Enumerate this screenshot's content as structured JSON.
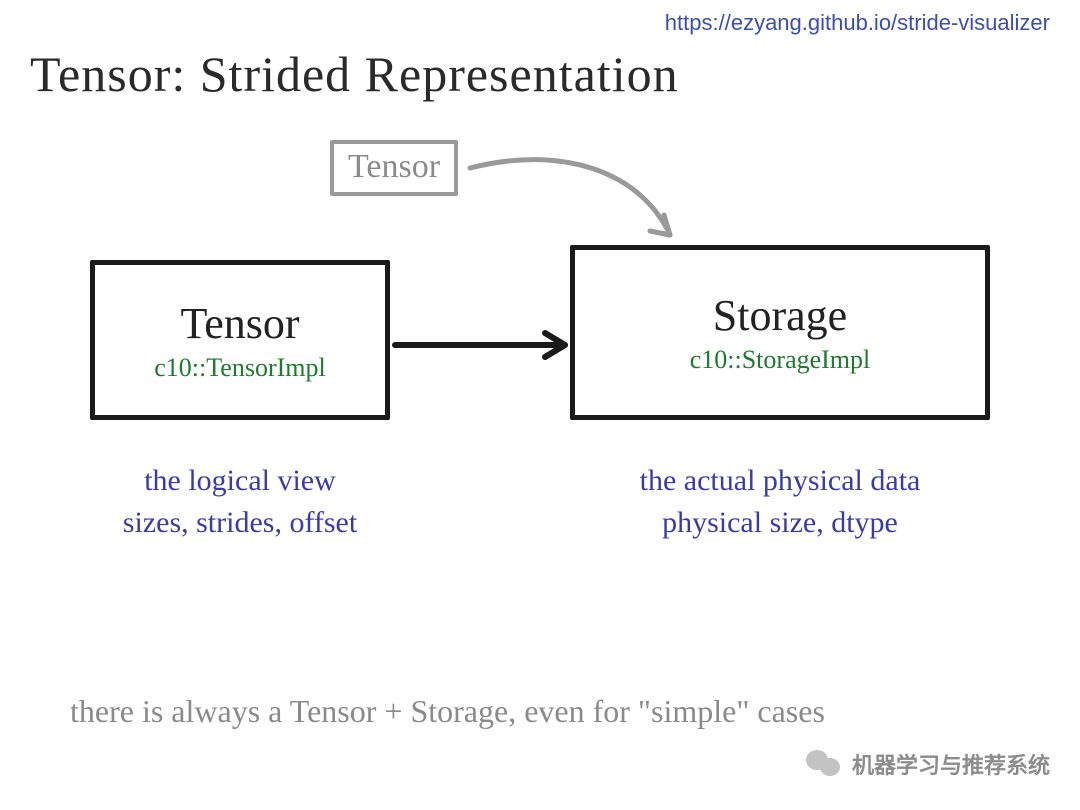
{
  "url": "https://ezyang.github.io/stride-visualizer",
  "title": "Tensor:  Strided  Representation",
  "small_tensor_label": "Tensor",
  "tensor_box": {
    "label": "Tensor",
    "impl": "c10::TensorImpl"
  },
  "storage_box": {
    "label": "Storage",
    "impl": "c10::StorageImpl"
  },
  "tensor_desc_line1": "the logical view",
  "tensor_desc_line2": "sizes, strides, offset",
  "storage_desc_line1": "the actual physical data",
  "storage_desc_line2": "physical size, dtype",
  "footnote": "there is always a Tensor + Storage,  even for  \"simple\"  cases",
  "watermark": "机器学习与推荐系统",
  "colors": {
    "link": "#3a4db8",
    "impl_text": "#1e7a2e",
    "desc_text": "#3a3ab0",
    "gray": "#8a8a8a"
  }
}
